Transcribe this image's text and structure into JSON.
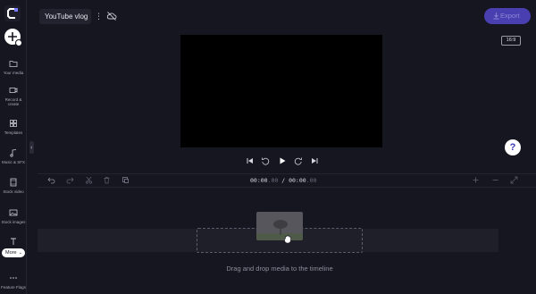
{
  "colors": {
    "background": "#161621",
    "accent": "#4a3fb0",
    "help_icon": "#3b3bb8"
  },
  "sidebar": {
    "logo_icon": "clipchamp-logo-icon",
    "add_icon": "plus-icon",
    "items": [
      {
        "label": "Your media",
        "icon": "folder-icon"
      },
      {
        "label": "Record & create",
        "icon": "video-camera-icon"
      },
      {
        "label": "Templates",
        "icon": "grid-icon"
      },
      {
        "label": "Music & SFX",
        "icon": "music-note-icon"
      },
      {
        "label": "Stock video",
        "icon": "film-icon"
      },
      {
        "label": "Stock images",
        "icon": "image-icon"
      },
      {
        "label": "Text",
        "icon": "text-icon"
      },
      {
        "label": "Feature Flags",
        "icon": "more-dots-icon"
      }
    ],
    "more_label": "More"
  },
  "header": {
    "project_title": "YouTube vlog",
    "export_label": "Export"
  },
  "preview": {
    "aspect_ratio": "16:9",
    "help_label": "?"
  },
  "timeline": {
    "current_time": "00:00",
    "current_frac": ".00",
    "separator": " / ",
    "total_time": "00:00",
    "total_frac": ".00",
    "drop_hint": "Drag and drop media to the timeline"
  }
}
